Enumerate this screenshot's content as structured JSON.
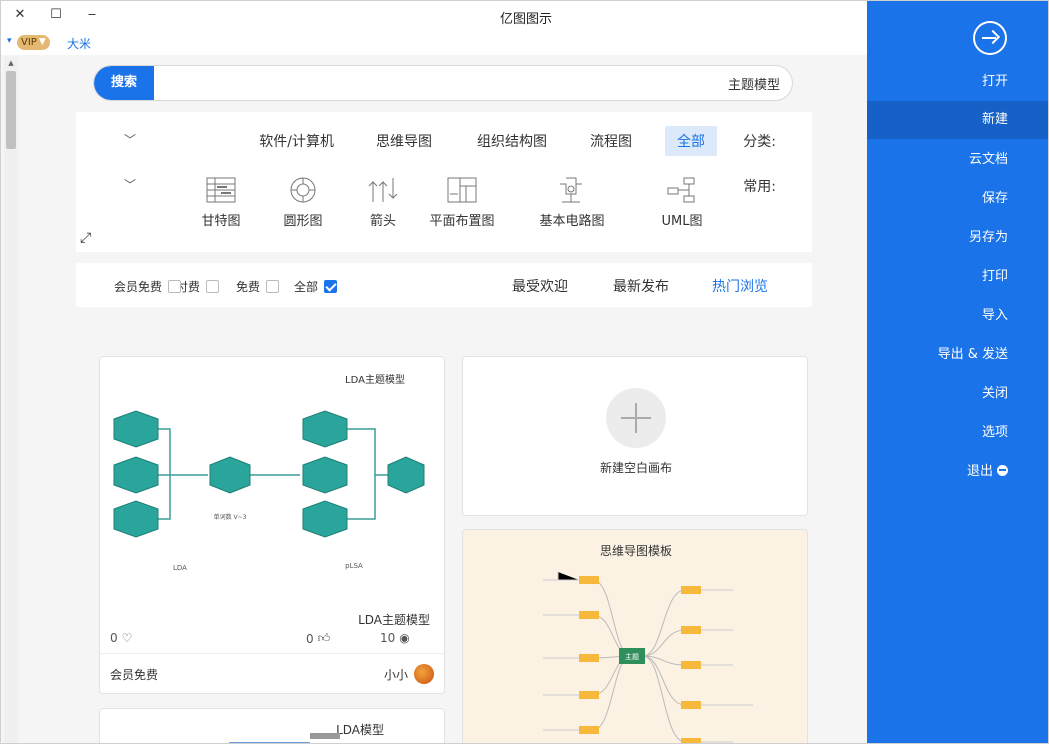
{
  "window": {
    "title": "亿图图示",
    "close_glyph": "✕",
    "maximize_glyph": "☐",
    "minimize_glyph": "‒"
  },
  "user": {
    "name": "大米",
    "vip_label": "VIP",
    "vip_color": "#e4b870"
  },
  "search": {
    "button_label": "搜索",
    "value": "主题模型"
  },
  "category": {
    "label": "分类:",
    "items": [
      "全部",
      "流程图",
      "组织结构图",
      "思维导图",
      "软件/计算机"
    ],
    "active_index": 0
  },
  "common": {
    "label": "常用:",
    "templates": [
      {
        "label": "UML图",
        "icon": "uml-icon"
      },
      {
        "label": "基本电路图",
        "icon": "circuit-icon"
      },
      {
        "label": "平面布置图",
        "icon": "floorplan-icon"
      },
      {
        "label": "箭头",
        "icon": "arrow-icon"
      },
      {
        "label": "圆形图",
        "icon": "circle-icon"
      },
      {
        "label": "甘特图",
        "icon": "gantt-icon"
      }
    ]
  },
  "filters": {
    "tabs": [
      "热门浏览",
      "最新发布",
      "最受欢迎"
    ],
    "active_tab": 0,
    "checkboxes": [
      {
        "label": "全部",
        "checked": true
      },
      {
        "label": "免费",
        "checked": false
      },
      {
        "label": "付费",
        "checked": false
      },
      {
        "label": "会员免费",
        "checked": false
      }
    ]
  },
  "cards": {
    "new_blank_label": "新建空白画布",
    "mindmap_title": "思维导图模板",
    "mindmap_center": "主题",
    "lda": {
      "title": "LDA主题模型",
      "views": "10",
      "likes": "0",
      "favorites": "0",
      "author": "小小",
      "price": "会员免费",
      "diagram_title": "LDA主题模型",
      "label_lda": "LDA",
      "label_plsa": "pLSA",
      "label_center": "单词数 V~3"
    },
    "lda2_title": "LDA模型"
  },
  "sidebar": {
    "items": [
      "打开",
      "新建",
      "云文档",
      "保存",
      "另存为",
      "打印",
      "导入",
      "导出 & 发送",
      "关闭",
      "选项",
      "退出"
    ],
    "active_index": 1,
    "color": "#1a73e8"
  }
}
